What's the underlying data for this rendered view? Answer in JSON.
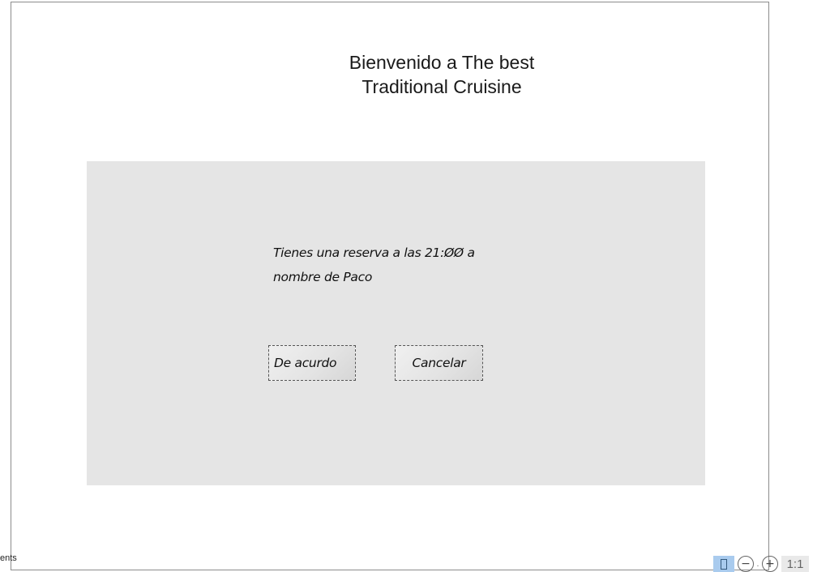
{
  "page": {
    "title_line1": "Bienvenido a The best",
    "title_line2": "Traditional Cruisine"
  },
  "dialog": {
    "message_line1": "Tienes una reserva a  las  21:ØØ a",
    "message_line2": "nombre de Paco",
    "ok_label": "De acurdo",
    "cancel_label": "Cancelar"
  },
  "statusbar": {
    "left_text": "ents",
    "zoom_out_glyph": "−",
    "zoom_in_glyph": "+",
    "separator_glyph": ".",
    "ratio_label": "1:1",
    "fit_icon": "page-fit-icon"
  },
  "colors": {
    "dialog_bg": "#e5e5e5",
    "frame_border": "#8c8c8c",
    "fit_active_bg": "#a9cbee"
  }
}
